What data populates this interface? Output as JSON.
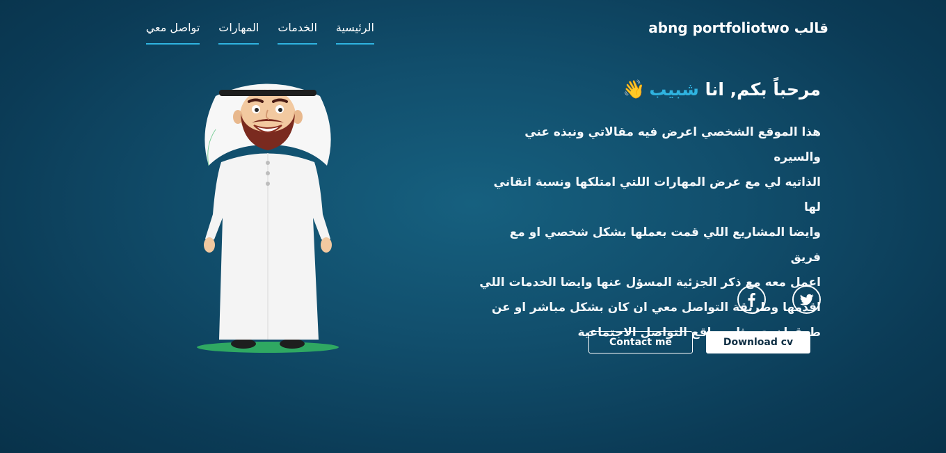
{
  "header": {
    "brand": "قالب abng portfoliotwo",
    "nav": [
      {
        "label": "الرئيسية"
      },
      {
        "label": "الخدمات"
      },
      {
        "label": "المهارات"
      },
      {
        "label": "تواصل معي"
      }
    ]
  },
  "hero": {
    "title_prefix": "مرحباً بكم, انا ",
    "title_name": "شبيب",
    "wave_emoji": "👋",
    "lines": [
      "هذا الموقع الشخصي اعرض فيه مقالاتي ونبذه عني والسيره",
      "الذاتيه لي مع عرض المهارات اللتي امتلكها ونسبة اتقاني لها",
      "وايضا المشاريع اللي قمت بعملها بشكل شخصي او مع فريق",
      "اعمل معه مع ذكر الجزئية المسؤل عنها وايضا الخدمات اللي",
      "اقدمها وطريقة التواصل معي ان كان بشكل مباشر او عن",
      "طرق اخرى مثل مواقع التواصل الاجتماعية"
    ],
    "social": [
      {
        "icon": "twitter-icon"
      },
      {
        "icon": "facebook-icon"
      }
    ],
    "buttons": {
      "download": "Download cv",
      "contact": "Contact me"
    }
  },
  "colors": {
    "accent": "#2fb3e0",
    "background": "#114e6c"
  }
}
